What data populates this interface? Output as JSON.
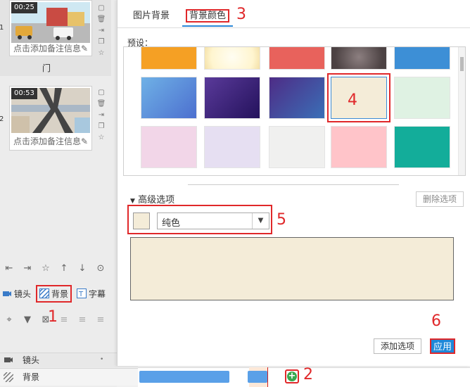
{
  "slides": [
    {
      "number": "1",
      "time": "00:25",
      "note": "点击添加备注信息",
      "label": "门"
    },
    {
      "number": "2",
      "time": "00:53",
      "note": "点击添加备注信息"
    }
  ],
  "modes": {
    "camera": "镜头",
    "background": "背景",
    "subtitle": "字幕"
  },
  "timeline": {
    "head_label": "镜头",
    "row_label": "背景"
  },
  "dialog": {
    "tabs": [
      "图片背景",
      "背景颜色"
    ],
    "preset_label": "预设：",
    "advanced_label": "高级选项",
    "delete_option": "删除选项",
    "fill_type": "纯色",
    "add_option": "添加选项",
    "apply": "应用",
    "selected_color": "#f4ecd8",
    "swatches": [
      {
        "color": "#f5a024",
        "kind": "solid"
      },
      {
        "color": "#fff5cf",
        "kind": "radial"
      },
      {
        "color": "#e8625c",
        "kind": "solid"
      },
      {
        "color": "#7a6d6e",
        "kind": "dark-radial"
      },
      {
        "color": "#3d8fd6",
        "kind": "solid"
      },
      {
        "color": "#5a9be0",
        "kind": "blue-grad"
      },
      {
        "color": "#3c2780",
        "kind": "purple-grad"
      },
      {
        "color": "#4a2f8a",
        "kind": "purple-blue"
      },
      {
        "color": "#f4ecd8",
        "kind": "solid"
      },
      {
        "color": "#dff2e3",
        "kind": "solid"
      },
      {
        "color": "#f2d6e8",
        "kind": "solid"
      },
      {
        "color": "#e6dff2",
        "kind": "solid"
      },
      {
        "color": "#f0f0ef",
        "kind": "solid"
      },
      {
        "color": "#ffc4c9",
        "kind": "solid"
      },
      {
        "color": "#13ad9a",
        "kind": "solid"
      }
    ]
  },
  "annotations": [
    "1",
    "2",
    "3",
    "4",
    "5",
    "6"
  ]
}
